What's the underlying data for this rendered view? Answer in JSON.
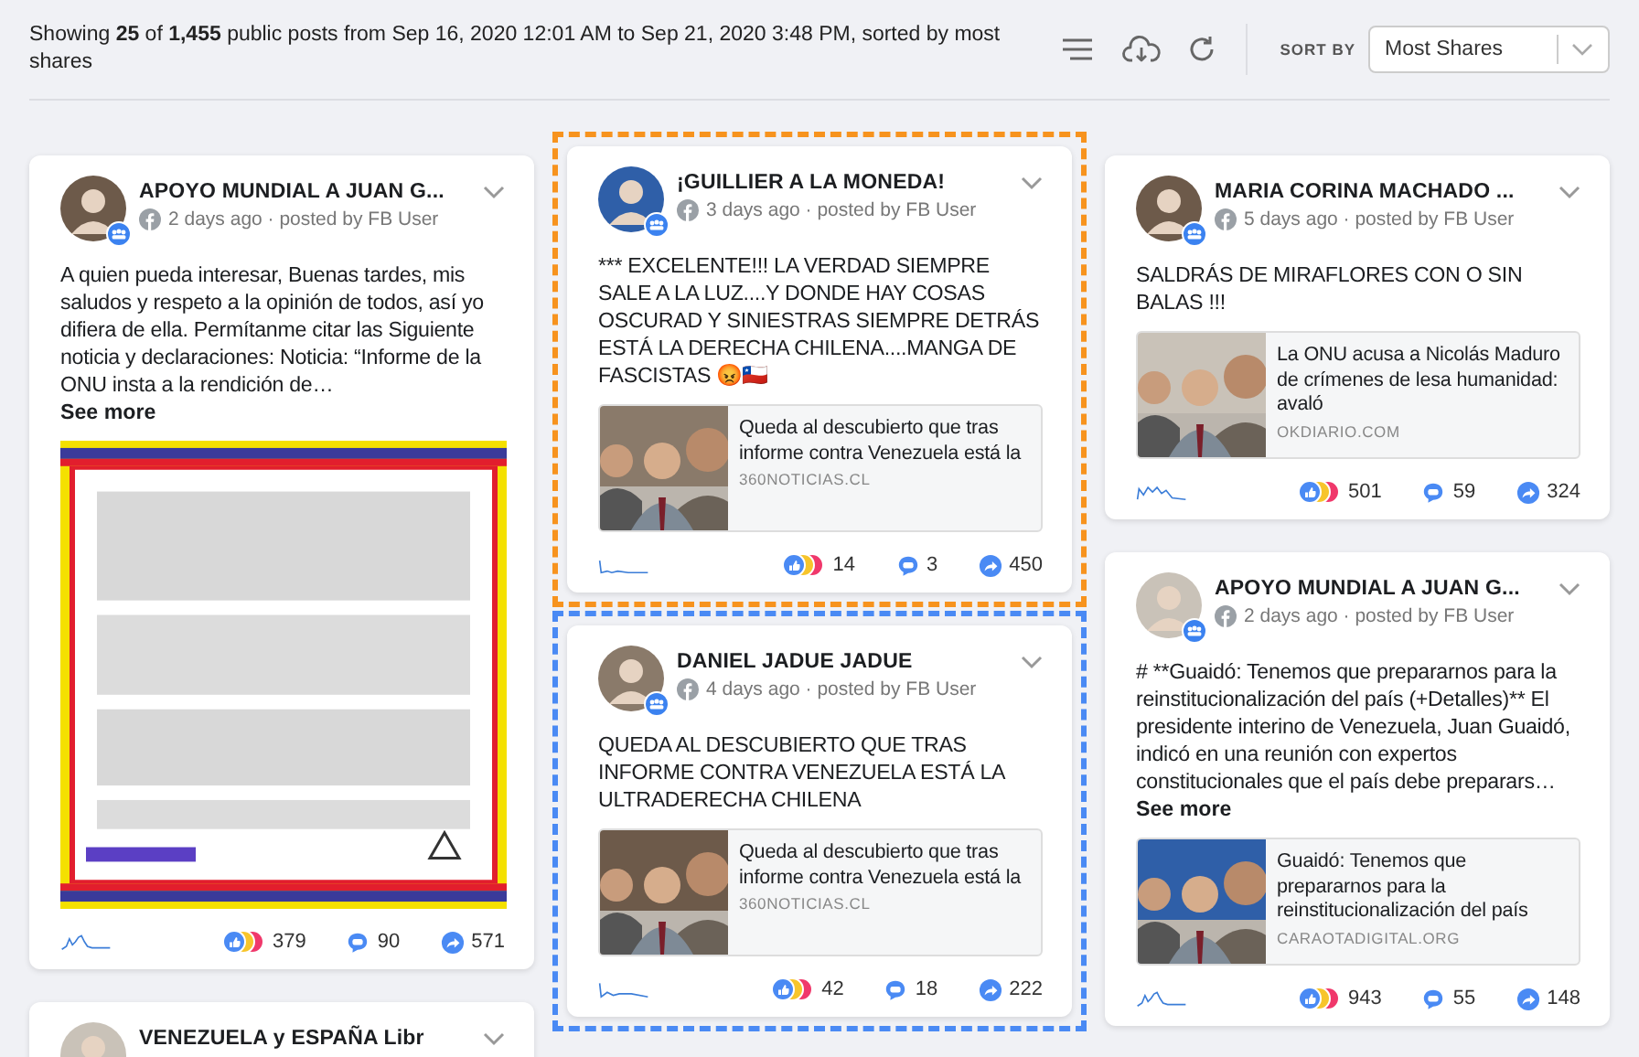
{
  "summary": "Showing **25** of **1,455** public posts from Sep 16, 2020 12:01 AM to Sep 21, 2020 3:48 PM, sorted by most shares",
  "sort": {
    "label": "SORT BY",
    "value": "Most Shares"
  },
  "columns": [
    {
      "posts": [
        {
          "author": "APOYO MUNDIAL A JUAN G...",
          "meta": "2 days ago · posted by FB User",
          "text": "A quien pueda interesar, Buenas tardes, mis saludos y respeto a la opinión de todos, así yo difiera de ella. Permítanme citar las Siguiente noticia y declaraciones: Noticia: “Informe de la ONU insta a la rendición de…",
          "see_more": "See more",
          "reactions": "379",
          "comments": "90",
          "shares": "571"
        },
        {
          "author": "VENEZUELA y ESPAÑA Libr"
        }
      ]
    },
    {
      "posts": [
        {
          "author": "¡GUILLIER A LA MONEDA!",
          "meta": "3 days ago · posted by FB User",
          "text": "*** EXCELENTE!!! LA VERDAD SIEMPRE SALE A LA LUZ....Y DONDE HAY COSAS OSCURAD Y SINIESTRAS SIEMPRE DETRÁS ESTÁ LA DERECHA CHILENA....MANGA DE FASCISTAS 😡🇨🇱",
          "link": {
            "title": "Queda al descubierto que tras informe contra Venezuela está la",
            "domain": "360NOTICIAS.CL"
          },
          "reactions": "14",
          "comments": "3",
          "shares": "450",
          "color": "#f7931e"
        },
        {
          "author": "DANIEL JADUE JADUE",
          "meta": "4 days ago · posted by FB User",
          "text": "QUEDA AL DESCUBIERTO QUE TRAS INFORME CONTRA VENEZUELA ESTÁ LA ULTRADERECHA CHILENA",
          "link": {
            "title": "Queda al descubierto que tras informe contra Venezuela está la",
            "domain": "360NOTICIAS.CL"
          },
          "reactions": "42",
          "comments": "18",
          "shares": "222",
          "color": "#4a8af4"
        }
      ]
    },
    {
      "posts": [
        {
          "author": "MARIA CORINA MACHADO ...",
          "meta": "5 days ago · posted by FB User",
          "text": "SALDRÁS DE MIRAFLORES CON O SIN BALAS !!!",
          "link": {
            "title": "La ONU acusa a Nicolás Maduro de crímenes de lesa humanidad: avaló",
            "domain": "OKDIARIO.COM"
          },
          "reactions": "501",
          "comments": "59",
          "shares": "324"
        },
        {
          "author": "APOYO MUNDIAL A JUAN G...",
          "meta": "2 days ago · posted by FB User",
          "text": "# **Guaidó: Tenemos que prepararnos para la reinstitucionalización del país (+Detalles)** El presidente interino de Venezuela, Juan Guaidó, indicó en una reunión con expertos constitucionales que el país debe preparars…",
          "see_more": "See more",
          "link": {
            "title": "Guaidó: Tenemos que prepararnos para la reinstitucionalización del país",
            "domain": "CARAOTADIGITAL.ORG"
          },
          "reactions": "943",
          "comments": "55",
          "shares": "148"
        }
      ]
    }
  ]
}
